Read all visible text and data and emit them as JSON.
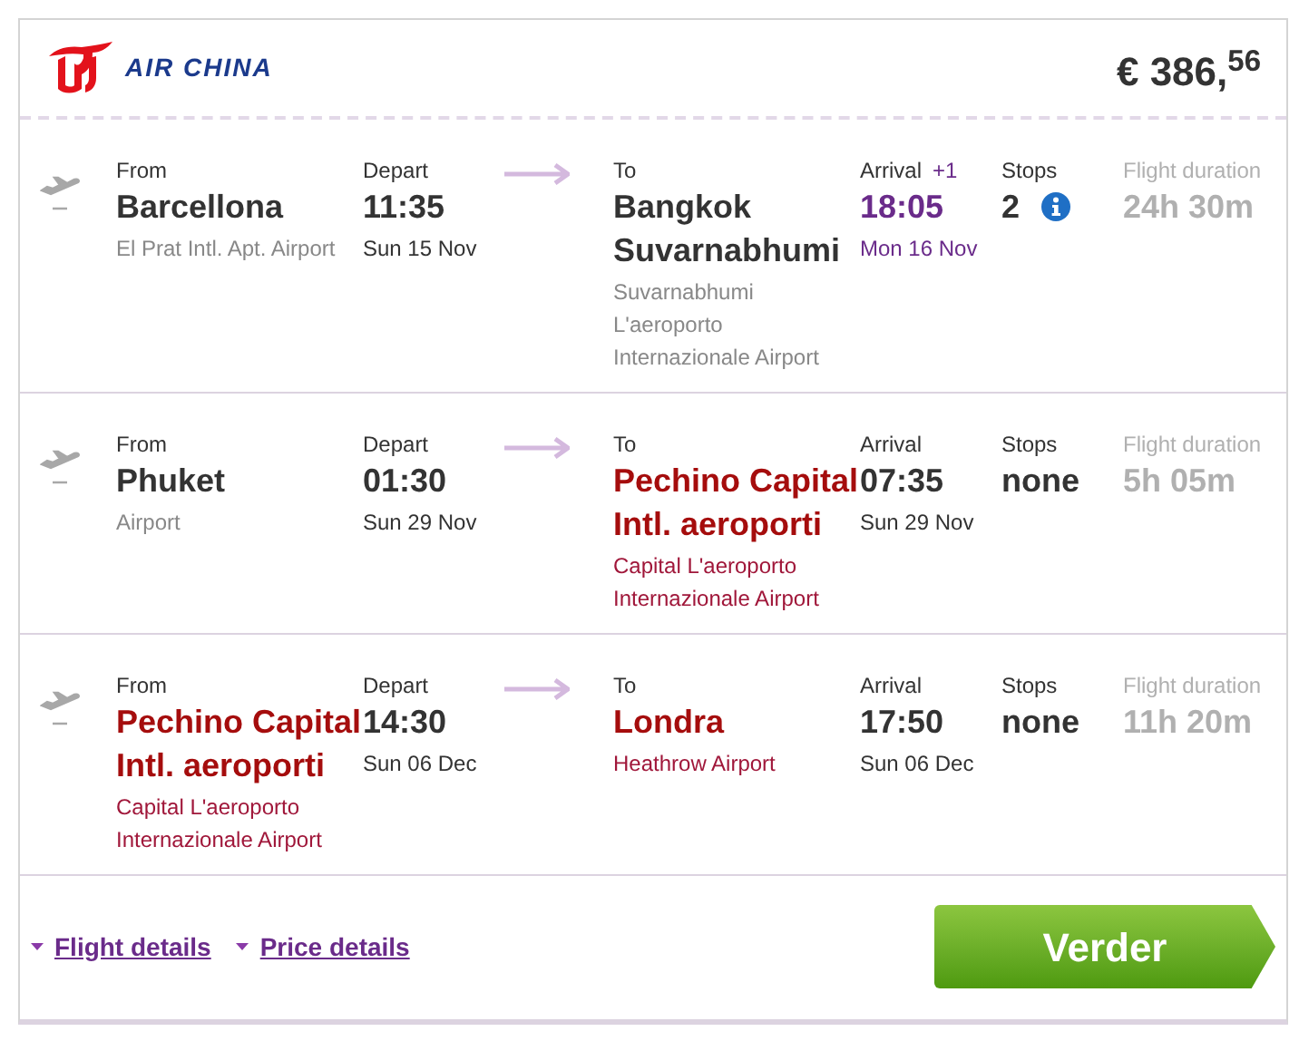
{
  "airline": {
    "name": "AIR CHINA"
  },
  "price": "€ 386,$^{56}$",
  "flights": [
    {
      "from_label": "From",
      "from": {
        "city": "Barcellona",
        "airport": "El Prat Intl. Apt. Airport",
        "highlight": false
      },
      "depart_label": "Depart",
      "depart_time": "11:35",
      "depart_date": "Sun 15 Nov",
      "to_label": "To",
      "to": {
        "city": "Bangkok Suvarnabhumi",
        "airport": "Suvarnabhumi L'aeroporto Internazionale Airport",
        "highlight": false
      },
      "arrival_label": "Arrival",
      "day_offset": "+1",
      "arrival_time": "18:05",
      "arrival_date": "Mon 16 Nov",
      "stops_label": "Stops",
      "stops": "2",
      "stops_info": true,
      "duration_label": "Flight duration",
      "duration": "24h 30m"
    },
    {
      "from_label": "From",
      "from": {
        "city": "Phuket",
        "airport": "Airport",
        "highlight": false
      },
      "depart_label": "Depart",
      "depart_time": "01:30",
      "depart_date": "Sun 29 Nov",
      "to_label": "To",
      "to": {
        "city": "Pechino Capital Intl. aeroporti",
        "airport": "Capital L'aeroporto Internazionale Airport",
        "highlight": true
      },
      "arrival_label": "Arrival",
      "arrival_time": "07:35",
      "arrival_date": "Sun 29 Nov",
      "stops_label": "Stops",
      "stops": "none",
      "stops_info": false,
      "duration_label": "Flight duration",
      "duration": "5h 05m"
    },
    {
      "from_label": "From",
      "from": {
        "city": "Pechino Capital Intl. aeroporti",
        "airport": "Capital L'aeroporto Internazionale Airport",
        "highlight": true
      },
      "depart_label": "Depart",
      "depart_time": "14:30",
      "depart_date": "Sun 06 Dec",
      "to_label": "To",
      "to": {
        "city": "Londra",
        "airport": "Heathrow Airport",
        "highlight": true
      },
      "arrival_label": "Arrival",
      "arrival_time": "17:50",
      "arrival_date": "Sun 06 Dec",
      "stops_label": "Stops",
      "stops": "none",
      "stops_info": false,
      "duration_label": "Flight duration",
      "duration": "11h 20m"
    }
  ],
  "links": [
    "Flight details",
    "Price details"
  ],
  "button": "Verder"
}
